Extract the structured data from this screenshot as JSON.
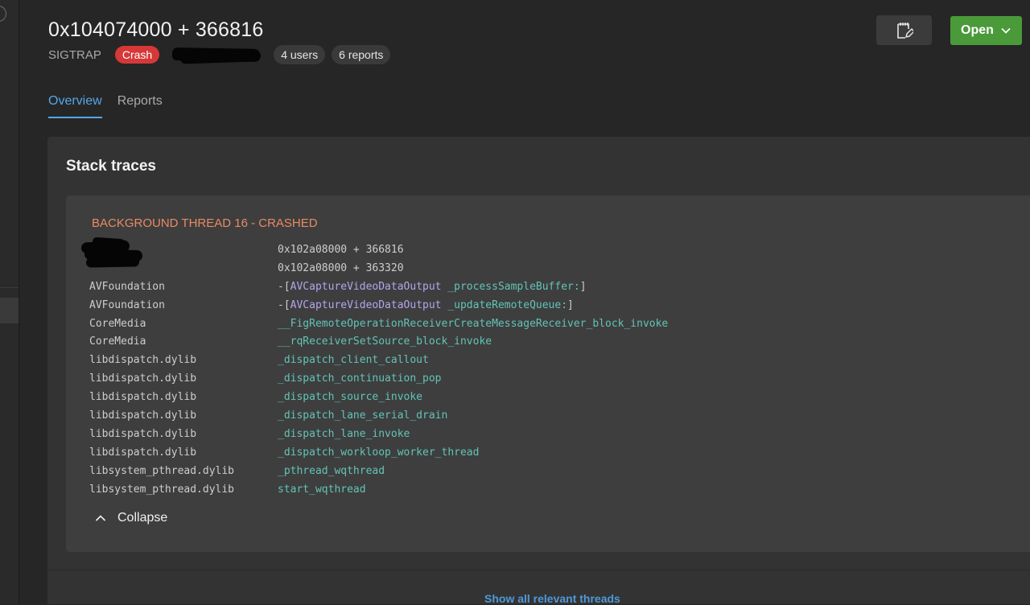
{
  "header": {
    "title": "0x104074000 + 366816",
    "signal": "SIGTRAP",
    "badge": "Crash",
    "users": "4 users",
    "reports": "6 reports"
  },
  "actions": {
    "note_icon": "notepad-edit-icon",
    "open_label": "Open",
    "open_icon": "chevron-down-icon"
  },
  "tabs": [
    {
      "label": "Overview",
      "active": true
    },
    {
      "label": "Reports",
      "active": false
    }
  ],
  "stack_traces": {
    "title": "Stack traces",
    "thread_title": "BACKGROUND THREAD 16 - CRASHED",
    "frames": [
      {
        "library": "",
        "symbol": [
          {
            "text": "0x102a08000 + 366816",
            "style": "addr"
          }
        ]
      },
      {
        "library": "",
        "symbol": [
          {
            "text": "0x102a08000 + 363320",
            "style": "addr"
          }
        ]
      },
      {
        "library": "AVFoundation",
        "symbol": [
          {
            "text": "-[",
            "style": "plain"
          },
          {
            "text": "AVCaptureVideoDataOutput",
            "style": "class"
          },
          {
            "text": " _processSampleBuffer:",
            "style": "func"
          },
          {
            "text": "]",
            "style": "plain"
          }
        ]
      },
      {
        "library": "AVFoundation",
        "symbol": [
          {
            "text": "-[",
            "style": "plain"
          },
          {
            "text": "AVCaptureVideoDataOutput",
            "style": "class"
          },
          {
            "text": " _updateRemoteQueue:",
            "style": "func"
          },
          {
            "text": "]",
            "style": "plain"
          }
        ]
      },
      {
        "library": "CoreMedia",
        "symbol": [
          {
            "text": "__FigRemoteOperationReceiverCreateMessageReceiver_block_invoke",
            "style": "func"
          }
        ]
      },
      {
        "library": "CoreMedia",
        "symbol": [
          {
            "text": "__rqReceiverSetSource_block_invoke",
            "style": "func"
          }
        ]
      },
      {
        "library": "libdispatch.dylib",
        "symbol": [
          {
            "text": "_dispatch_client_callout",
            "style": "func"
          }
        ]
      },
      {
        "library": "libdispatch.dylib",
        "symbol": [
          {
            "text": "_dispatch_continuation_pop",
            "style": "func"
          }
        ]
      },
      {
        "library": "libdispatch.dylib",
        "symbol": [
          {
            "text": "_dispatch_source_invoke",
            "style": "func"
          }
        ]
      },
      {
        "library": "libdispatch.dylib",
        "symbol": [
          {
            "text": "_dispatch_lane_serial_drain",
            "style": "func"
          }
        ]
      },
      {
        "library": "libdispatch.dylib",
        "symbol": [
          {
            "text": "_dispatch_lane_invoke",
            "style": "func"
          }
        ]
      },
      {
        "library": "libdispatch.dylib",
        "symbol": [
          {
            "text": "_dispatch_workloop_worker_thread",
            "style": "func"
          }
        ]
      },
      {
        "library": "libsystem_pthread.dylib",
        "symbol": [
          {
            "text": "_pthread_wqthread",
            "style": "func"
          }
        ]
      },
      {
        "library": "libsystem_pthread.dylib",
        "symbol": [
          {
            "text": "start_wqthread",
            "style": "func"
          }
        ]
      }
    ],
    "collapse_label": "Collapse",
    "collapse_icon": "chevron-up-icon",
    "show_all_label": "Show all relevant threads"
  },
  "colors": {
    "crash_badge": "#d63838",
    "open_button": "#4a9a3a",
    "tab_active": "#56a6ea",
    "thread_title": "#e98a63",
    "symbol_func": "#62c3b6",
    "symbol_class": "#b3a5ee",
    "link": "#4f99d8"
  }
}
